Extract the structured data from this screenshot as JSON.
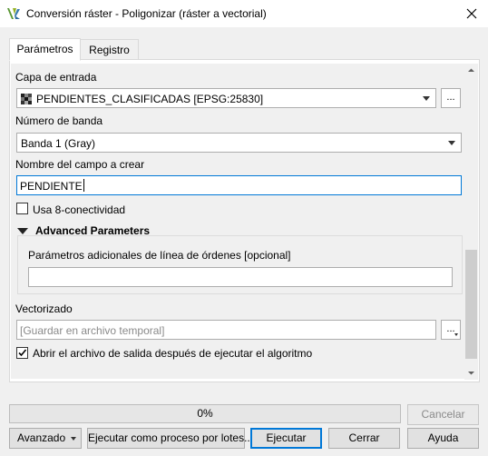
{
  "window": {
    "title": "Conversión ráster - Poligonizar (ráster a vectorial)",
    "app_icon": "qgis-logo-icon",
    "close_icon": "close-icon"
  },
  "tabs": [
    {
      "label": "Parámetros",
      "active": true
    },
    {
      "label": "Registro",
      "active": false
    }
  ],
  "form": {
    "input_layer": {
      "label": "Capa de entrada",
      "value": "PENDIENTES_CLASIFICADAS [EPSG:25830]",
      "browse_label": "..."
    },
    "band": {
      "label": "Número de banda",
      "value": "Banda 1 (Gray)"
    },
    "field_name": {
      "label": "Nombre del campo a crear",
      "value": "PENDIENTE"
    },
    "eight_connectedness": {
      "label": "Usa 8-conectividad",
      "checked": false
    },
    "advanced": {
      "label": "Advanced Parameters",
      "expanded": true,
      "extra_params": {
        "label": "Parámetros adicionales de línea de órdenes [opcional]",
        "value": ""
      }
    },
    "output": {
      "label": "Vectorizado",
      "placeholder": "[Guardar en archivo temporal]",
      "browse_label": "..."
    },
    "open_output": {
      "label": "Abrir el archivo de salida después de ejecutar el algoritmo",
      "checked": true
    }
  },
  "progress": {
    "value": 0,
    "text": "0%"
  },
  "buttons": {
    "cancel": "Cancelar",
    "advanced": "Avanzado",
    "batch": "Ejecutar como proceso por lotes...",
    "run": "Ejecutar",
    "close": "Cerrar",
    "help": "Ayuda"
  }
}
